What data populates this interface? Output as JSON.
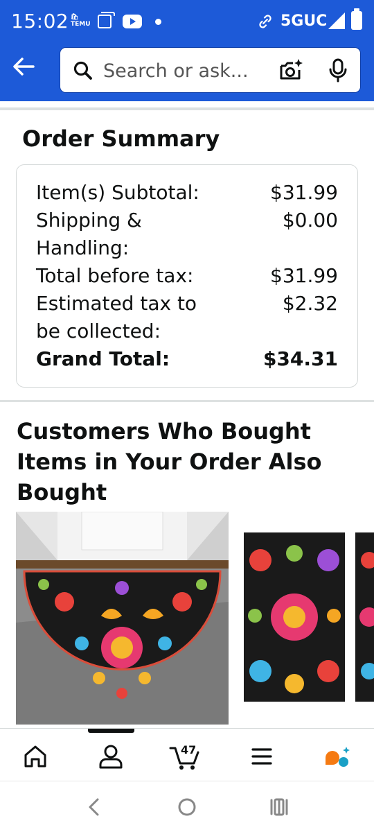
{
  "status_bar": {
    "time": "15:02",
    "app_badge": "🛍 TEMU",
    "network": "5GUC",
    "icons": [
      "temu-notification-icon",
      "screen-icon",
      "youtube-icon",
      "dot-icon",
      "link-icon",
      "signal-icon",
      "battery-icon"
    ]
  },
  "header": {
    "search_placeholder": "Search or ask...",
    "icons": [
      "back-arrow-icon",
      "search-icon",
      "camera-icon",
      "mic-icon"
    ],
    "accent_color": "#1d5ad8"
  },
  "order_summary": {
    "title": "Order Summary",
    "rows": [
      {
        "label": "Item(s) Subtotal:",
        "value": "$31.99"
      },
      {
        "label": "Shipping & Handling:",
        "value": "$0.00"
      },
      {
        "label": "Total before tax:",
        "value": "$31.99"
      },
      {
        "label": "Estimated tax to be collected:",
        "value": "$2.32"
      },
      {
        "label": "Grand Total:",
        "value": "$34.31"
      }
    ]
  },
  "recommendations": {
    "title": "Customers Who Bought Items in Your Order Also Bought",
    "products": [
      "half-round-floral-doormat",
      "floral-runner-rug",
      "floral-runner-rug-partial"
    ]
  },
  "bottom_nav": {
    "items": [
      "home-icon",
      "account-icon",
      "cart-icon",
      "menu-icon",
      "rufus-ai-icon"
    ],
    "cart_count": "47",
    "active": "account-icon"
  },
  "system_nav": {
    "items": [
      "back-icon",
      "home-circle-icon",
      "recents-icon"
    ]
  }
}
